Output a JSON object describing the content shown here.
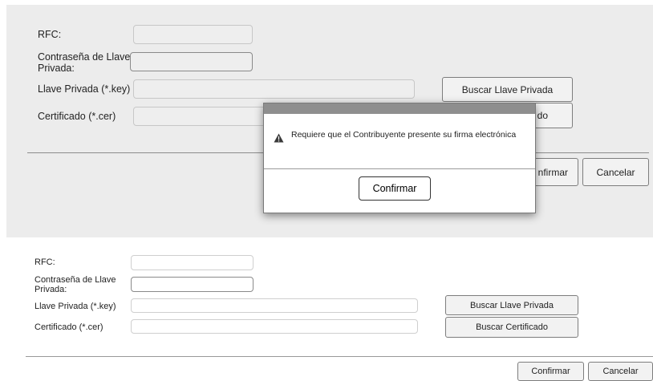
{
  "upper_form": {
    "rfc_label": "RFC:",
    "password_label": "Contraseña de Llave Privada:",
    "private_key_label": "Llave Privada (*.key)",
    "certificate_label": "Certificado (*.cer)",
    "browse_key_button": "Buscar Llave Privada",
    "browse_cert_button_partial": "do",
    "confirm_button_partial": "nfirmar",
    "cancel_button": "Cancelar"
  },
  "modal": {
    "message": "Requiere que el Contribuyente presente su firma electrónica",
    "confirm_button": "Confirmar",
    "icon": "warning-icon"
  },
  "lower_form": {
    "rfc_label": "RFC:",
    "password_label": "Contraseña de Llave Privada:",
    "private_key_label": "Llave Privada (*.key)",
    "certificate_label": "Certificado (*.cer)",
    "browse_key_button": "Buscar Llave Privada",
    "browse_cert_button": "Buscar Certificado",
    "confirm_button": "Confirmar",
    "cancel_button": "Cancelar"
  }
}
